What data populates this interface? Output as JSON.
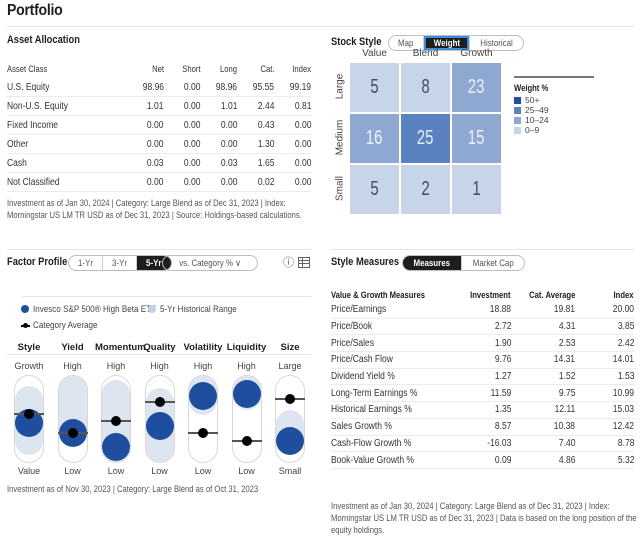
{
  "page_title": "Portfolio",
  "asset_allocation": {
    "title": "Asset Allocation",
    "columns": [
      "Asset Class",
      "Net",
      "Short",
      "Long",
      "Cat.",
      "Index"
    ],
    "rows": [
      [
        "U.S. Equity",
        "98.96",
        "0.00",
        "98.96",
        "95.55",
        "99.19"
      ],
      [
        "Non-U.S. Equity",
        "1.01",
        "0.00",
        "1.01",
        "2.44",
        "0.81"
      ],
      [
        "Fixed Income",
        "0.00",
        "0.00",
        "0.00",
        "0.43",
        "0.00"
      ],
      [
        "Other",
        "0.00",
        "0.00",
        "0.00",
        "1.30",
        "0.00"
      ],
      [
        "Cash",
        "0.03",
        "0.00",
        "0.03",
        "1.65",
        "0.00"
      ],
      [
        "Not Classified",
        "0.00",
        "0.00",
        "0.00",
        "0.02",
        "0.00"
      ]
    ],
    "note_line1": "Investment as of Jan 30, 2024 | Category: Large Blend as of Dec 31, 2023 | Index:",
    "note_line2": "Morningstar US LM TR USD as of Dec 31, 2023 | Source: Holdings-based calculations."
  },
  "stock_style": {
    "title": "Stock Style",
    "tabs": [
      {
        "label": "Map",
        "active": false
      },
      {
        "label": "Weight",
        "active": true
      },
      {
        "label": "Historical",
        "active": false
      }
    ],
    "col_labels": [
      "Value",
      "Blend",
      "Growth"
    ],
    "row_labels": [
      "Large",
      "Medium",
      "Small"
    ],
    "weights": [
      [
        5,
        8,
        23
      ],
      [
        16,
        25,
        15
      ],
      [
        5,
        2,
        1
      ]
    ],
    "legend_title": "Weight %",
    "legend": [
      {
        "label": "50+",
        "color": "#1f4e9f"
      },
      {
        "label": "25–49",
        "color": "#5a81c0"
      },
      {
        "label": "10–24",
        "color": "#8ea8d2"
      },
      {
        "label": "0–9",
        "color": "#c8d5e8"
      }
    ]
  },
  "factor_profile": {
    "title": "Factor Profile",
    "periods": [
      {
        "label": "1-Yr",
        "active": false
      },
      {
        "label": "3-Yr",
        "active": false
      },
      {
        "label": "5-Yr",
        "active": true
      }
    ],
    "comparison_select": "vs. Category % ∨",
    "info_icon": "ⓘ",
    "legend": {
      "fund": "Invesco S&P 500® High Beta ETF",
      "range": "5-Yr Historical Range",
      "category": "Category Average"
    },
    "factors": [
      {
        "name": "Style",
        "high": "Growth",
        "low": "Value",
        "fund": 0.45,
        "cat": 0.56,
        "range": [
          0.08,
          0.88
        ]
      },
      {
        "name": "Yield",
        "high": "High",
        "low": "Low",
        "fund": 0.34,
        "cat": 0.34,
        "range": [
          0.2,
          1.0
        ]
      },
      {
        "name": "Momentum",
        "high": "High",
        "low": "Low",
        "fund": 0.17,
        "cat": 0.48,
        "range": [
          0.0,
          0.95
        ]
      },
      {
        "name": "Quality",
        "high": "High",
        "low": "Low",
        "fund": 0.42,
        "cat": 0.7,
        "range": [
          0.0,
          0.86
        ]
      },
      {
        "name": "Volatility",
        "high": "High",
        "low": "Low",
        "fund": 0.77,
        "cat": 0.34,
        "range": [
          0.55,
          1.0
        ]
      },
      {
        "name": "Liquidity",
        "high": "High",
        "low": "Low",
        "fund": 0.79,
        "cat": 0.24,
        "range": [
          0.6,
          1.0
        ]
      },
      {
        "name": "Size",
        "high": "Large",
        "low": "Small",
        "fund": 0.24,
        "cat": 0.73,
        "range": [
          0.12,
          0.6
        ]
      }
    ],
    "note": "Investment as of Nov 30, 2023 | Category: Large Blend as of Oct 31, 2023"
  },
  "style_measures": {
    "title": "Style Measures",
    "tabs": [
      {
        "label": "Measures",
        "active": true
      },
      {
        "label": "Market Cap",
        "active": false
      }
    ],
    "columns": [
      "Value & Growth Measures",
      "Investment",
      "Cat. Average",
      "Index"
    ],
    "rows": [
      [
        "Price/Earnings",
        "18.88",
        "19.81",
        "20.00"
      ],
      [
        "Price/Book",
        "2.72",
        "4.31",
        "3.85"
      ],
      [
        "Price/Sales",
        "1.90",
        "2.53",
        "2.42"
      ],
      [
        "Price/Cash Flow",
        "9.76",
        "14.31",
        "14.01"
      ],
      [
        "Dividend Yield %",
        "1.27",
        "1.52",
        "1.53"
      ],
      [
        "Long-Term Earnings %",
        "11.59",
        "9.75",
        "10.99"
      ],
      [
        "Historical Earnings %",
        "1.35",
        "12.11",
        "15.03"
      ],
      [
        "Sales Growth %",
        "8.57",
        "10.38",
        "12.42"
      ],
      [
        "Cash-Flow Growth %",
        "-16.03",
        "7.40",
        "8.78"
      ],
      [
        "Book-Value Growth %",
        "0.09",
        "4.86",
        "5.32"
      ]
    ],
    "note_line1": "Investment as of Jan 30, 2024 | Category: Large Blend as of Dec 31, 2023 | Index:",
    "note_line2": "Morningstar US LM TR USD as of Dec 31, 2023 | Data is based on the long position of the",
    "note_line3": "equity holdings."
  }
}
